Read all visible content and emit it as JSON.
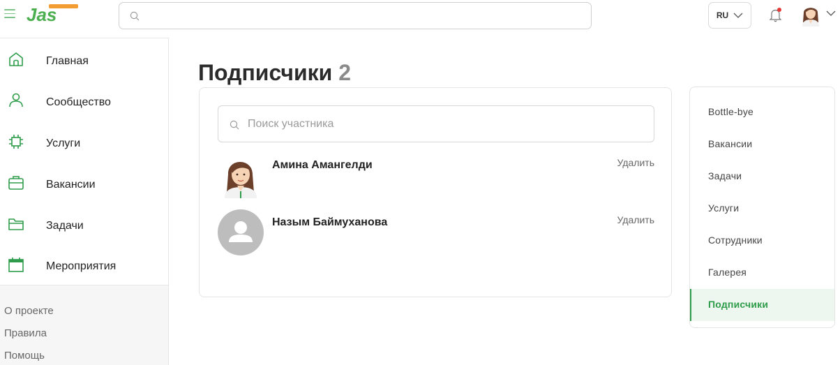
{
  "header": {
    "search_placeholder": "",
    "lang": "RU",
    "brand_color": "#2e9c4a"
  },
  "sidebar": {
    "items": [
      {
        "label": "Главная",
        "icon": "home-icon"
      },
      {
        "label": "Сообщество",
        "icon": "user-icon"
      },
      {
        "label": "Услуги",
        "icon": "chip-icon"
      },
      {
        "label": "Вакансии",
        "icon": "briefcase-icon"
      },
      {
        "label": "Задачи",
        "icon": "folder-icon"
      },
      {
        "label": "Мероприятия",
        "icon": "calendar-icon"
      }
    ],
    "footer_links": [
      "О проекте",
      "Правила",
      "Помощь"
    ]
  },
  "main": {
    "title": "Подписчики",
    "count": "2",
    "search_placeholder": "Поиск участника",
    "members": [
      {
        "name": "Амина Амангелди",
        "action": "Удалить"
      },
      {
        "name": "Назым Баймуханова",
        "action": "Удалить"
      }
    ]
  },
  "right_menu": {
    "items": [
      "Bottle-bye",
      "Вакансии",
      "Задачи",
      "Услуги",
      "Сотрудники",
      "Галерея",
      "Подписчики"
    ],
    "active": "Подписчики"
  }
}
